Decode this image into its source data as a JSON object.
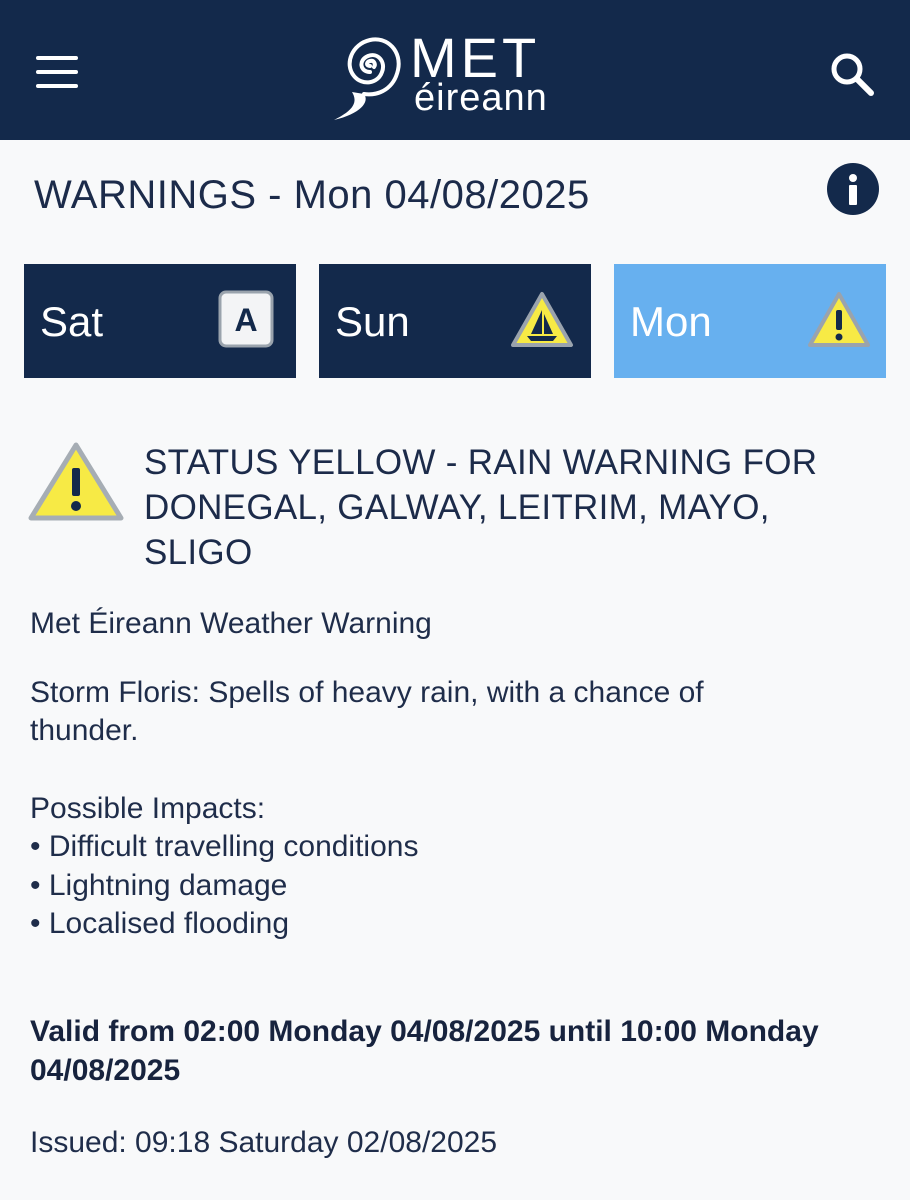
{
  "header": {
    "logo_met": "MET",
    "logo_eireann": "éireann"
  },
  "page": {
    "title": "WARNINGS - Mon 04/08/2025"
  },
  "tabs": [
    {
      "label": "Sat",
      "icon": "status-a-icon",
      "active": false
    },
    {
      "label": "Sun",
      "icon": "marine-warning-icon",
      "active": false
    },
    {
      "label": "Mon",
      "icon": "yellow-warning-icon",
      "active": true
    }
  ],
  "colors": {
    "header_bg": "#13294b",
    "tab_bg": "#13294b",
    "tab_active_bg": "#67b0ef",
    "warning_yellow": "#f7ea45"
  },
  "warning": {
    "title_lines": [
      "STATUS YELLOW - RAIN WARNING FOR",
      "DONEGAL, GALWAY, LEITRIM, MAYO,",
      "SLIGO"
    ],
    "source": "Met Éireann Weather Warning",
    "description_lines": [
      "Storm Floris: Spells of heavy rain, with a chance of",
      "thunder."
    ],
    "impacts_heading": "Possible Impacts:",
    "impacts": [
      "Difficult travelling conditions",
      "Lightning damage",
      "Localised flooding"
    ],
    "valid_lines": [
      "Valid from 02:00 Monday 04/08/2025 until 10:00 Monday",
      "04/08/2025"
    ],
    "issued": "Issued: 09:18 Saturday 02/08/2025"
  }
}
